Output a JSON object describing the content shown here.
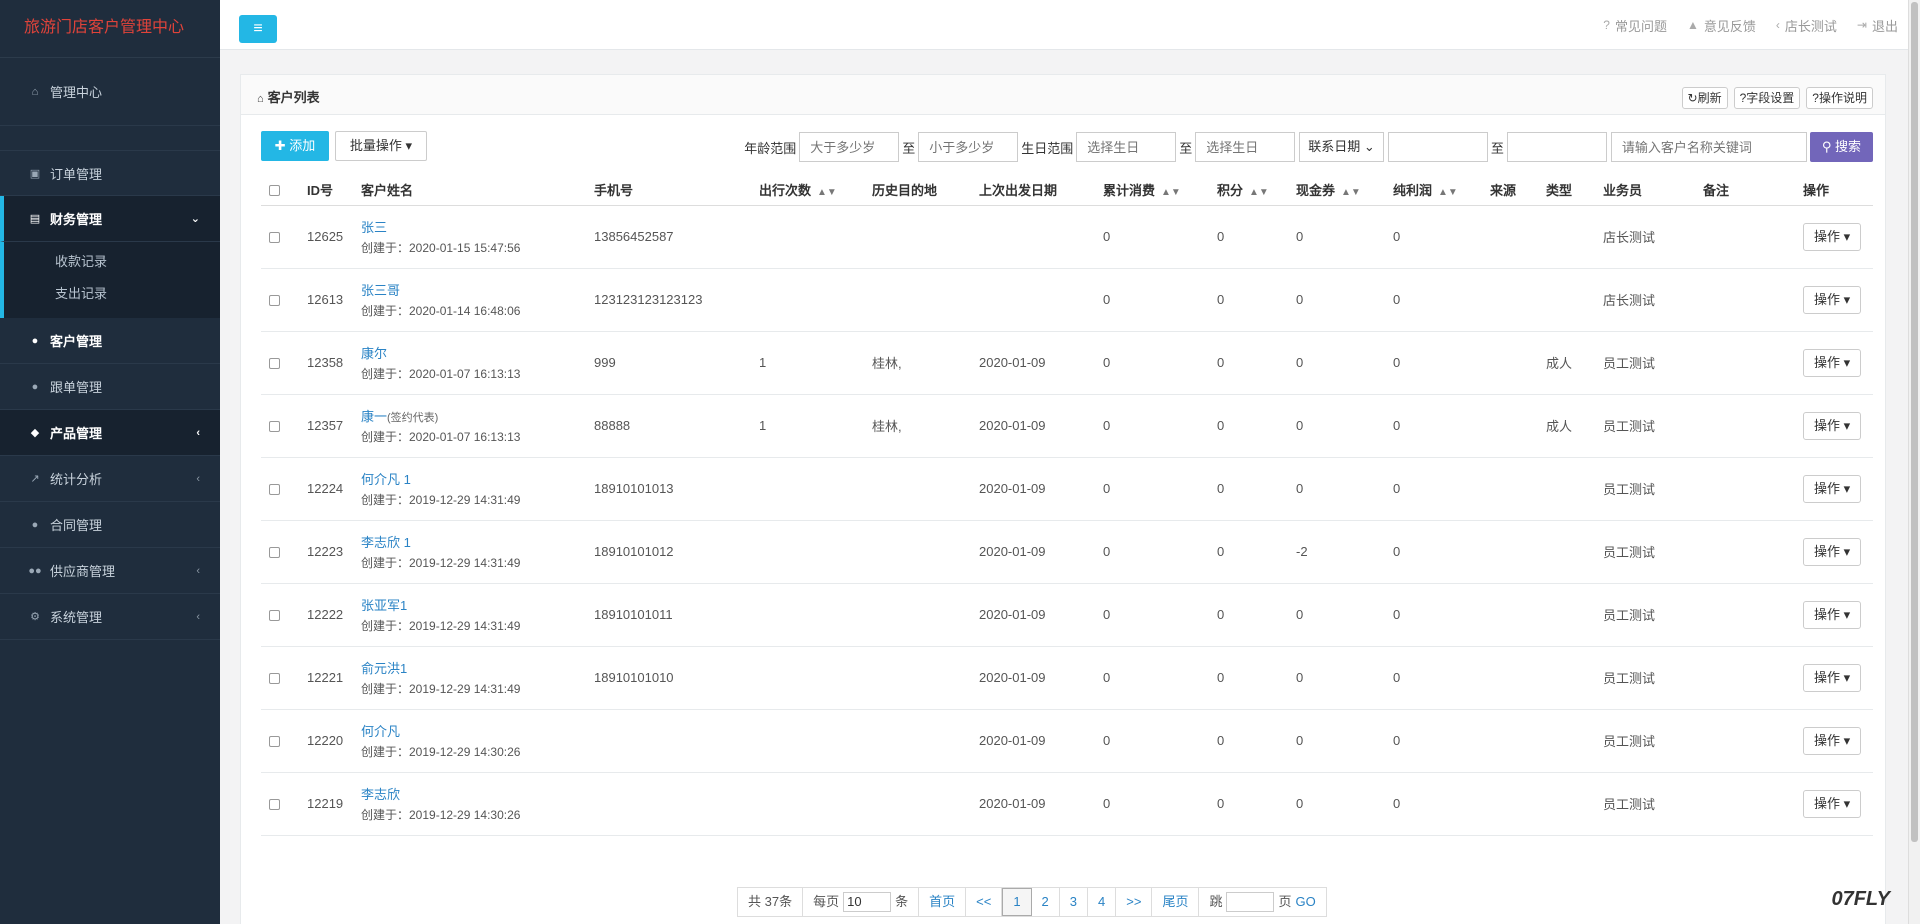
{
  "app": {
    "title": "旅游门店客户管理中心"
  },
  "sidebar": {
    "home": "管理中心",
    "items": [
      {
        "label": "订单管理"
      },
      {
        "label": "财务管理"
      },
      {
        "label": "客户管理"
      },
      {
        "label": "跟单管理"
      },
      {
        "label": "产品管理"
      },
      {
        "label": "统计分析"
      },
      {
        "label": "合同管理"
      },
      {
        "label": "供应商管理"
      },
      {
        "label": "系统管理"
      }
    ],
    "finance_sub": [
      "收款记录",
      "支出记录"
    ]
  },
  "topbar": {
    "links": [
      "常见问题",
      "意见反馈",
      "店长测试",
      "退出"
    ]
  },
  "panel": {
    "title": "客户列表",
    "head_buttons": [
      "刷新",
      "字段设置",
      "操作说明"
    ]
  },
  "toolbar": {
    "add": "添加",
    "batch": "批量操作",
    "age_label": "年龄范围",
    "age_min_ph": "大于多少岁",
    "to": "至",
    "age_max_ph": "小于多少岁",
    "birth_label": "生日范围",
    "birth_start_ph": "选择生日",
    "birth_end_ph": "选择生日",
    "contact_select": "联系日期",
    "keyword_ph": "请输入客户名称关键词",
    "search": "搜索"
  },
  "table": {
    "headers": [
      "ID号",
      "客户姓名",
      "手机号",
      "出行次数",
      "历史目的地",
      "上次出发日期",
      "累计消费",
      "积分",
      "现金券",
      "纯利润",
      "来源",
      "类型",
      "业务员",
      "备注",
      "操作"
    ],
    "op_label": "操作",
    "rows": [
      {
        "id": "12625",
        "name": "张三",
        "tag": "",
        "created": "创建于：2020-01-15 15:47:56",
        "phone": "13856452587",
        "trips": "",
        "dest": "",
        "last": "",
        "spend": "0",
        "points": "0",
        "coupon": "0",
        "profit": "0",
        "source": "",
        "type": "",
        "staff": "店长测试",
        "note": ""
      },
      {
        "id": "12613",
        "name": "张三哥",
        "tag": "",
        "created": "创建于：2020-01-14 16:48:06",
        "phone": "123123123123123",
        "trips": "",
        "dest": "",
        "last": "",
        "spend": "0",
        "points": "0",
        "coupon": "0",
        "profit": "0",
        "source": "",
        "type": "",
        "staff": "店长测试",
        "note": ""
      },
      {
        "id": "12358",
        "name": "康尔",
        "tag": "",
        "created": "创建于：2020-01-07 16:13:13",
        "phone": "999",
        "trips": "1",
        "dest": "桂林,",
        "last": "2020-01-09",
        "spend": "0",
        "points": "0",
        "coupon": "0",
        "profit": "0",
        "source": "",
        "type": "成人",
        "staff": "员工测试",
        "note": ""
      },
      {
        "id": "12357",
        "name": "康一",
        "tag": "(签约代表)",
        "created": "创建于：2020-01-07 16:13:13",
        "phone": "88888",
        "trips": "1",
        "dest": "桂林,",
        "last": "2020-01-09",
        "spend": "0",
        "points": "0",
        "coupon": "0",
        "profit": "0",
        "source": "",
        "type": "成人",
        "staff": "员工测试",
        "note": ""
      },
      {
        "id": "12224",
        "name": "何介凡 1",
        "tag": "",
        "created": "创建于：2019-12-29 14:31:49",
        "phone": "18910101013",
        "trips": "",
        "dest": "",
        "last": "2020-01-09",
        "spend": "0",
        "points": "0",
        "coupon": "0",
        "profit": "0",
        "source": "",
        "type": "",
        "staff": "员工测试",
        "note": ""
      },
      {
        "id": "12223",
        "name": "李志欣 1",
        "tag": "",
        "created": "创建于：2019-12-29 14:31:49",
        "phone": "18910101012",
        "trips": "",
        "dest": "",
        "last": "2020-01-09",
        "spend": "0",
        "points": "0",
        "coupon": "-2",
        "profit": "0",
        "source": "",
        "type": "",
        "staff": "员工测试",
        "note": ""
      },
      {
        "id": "12222",
        "name": "张亚军1",
        "tag": "",
        "created": "创建于：2019-12-29 14:31:49",
        "phone": "18910101011",
        "trips": "",
        "dest": "",
        "last": "2020-01-09",
        "spend": "0",
        "points": "0",
        "coupon": "0",
        "profit": "0",
        "source": "",
        "type": "",
        "staff": "员工测试",
        "note": ""
      },
      {
        "id": "12221",
        "name": "俞元洪1",
        "tag": "",
        "created": "创建于：2019-12-29 14:31:49",
        "phone": "18910101010",
        "trips": "",
        "dest": "",
        "last": "2020-01-09",
        "spend": "0",
        "points": "0",
        "coupon": "0",
        "profit": "0",
        "source": "",
        "type": "",
        "staff": "员工测试",
        "note": ""
      },
      {
        "id": "12220",
        "name": "何介凡",
        "tag": "",
        "created": "创建于：2019-12-29 14:30:26",
        "phone": "",
        "trips": "",
        "dest": "",
        "last": "2020-01-09",
        "spend": "0",
        "points": "0",
        "coupon": "0",
        "profit": "0",
        "source": "",
        "type": "",
        "staff": "员工测试",
        "note": ""
      },
      {
        "id": "12219",
        "name": "李志欣",
        "tag": "",
        "created": "创建于：2019-12-29 14:30:26",
        "phone": "",
        "trips": "",
        "dest": "",
        "last": "2020-01-09",
        "spend": "0",
        "points": "0",
        "coupon": "0",
        "profit": "0",
        "source": "",
        "type": "",
        "staff": "员工测试",
        "note": ""
      }
    ]
  },
  "pager": {
    "total": "共 37条",
    "per_page_pre": "每页",
    "per_page": "10",
    "per_page_post": "条",
    "first": "首页",
    "prev": "<<",
    "pages": [
      "1",
      "2",
      "3",
      "4"
    ],
    "next": ">>",
    "last": "尾页",
    "jump_pre": "跳",
    "jump_post": "页",
    "go": "GO"
  },
  "watermark": {
    "brand": "07FLY"
  },
  "colors": {
    "accent": "#23b7e5",
    "search": "#7266ba",
    "sidebar": "#1f2d3d",
    "brand_title": "#e0433a",
    "link": "#2a83c5"
  }
}
